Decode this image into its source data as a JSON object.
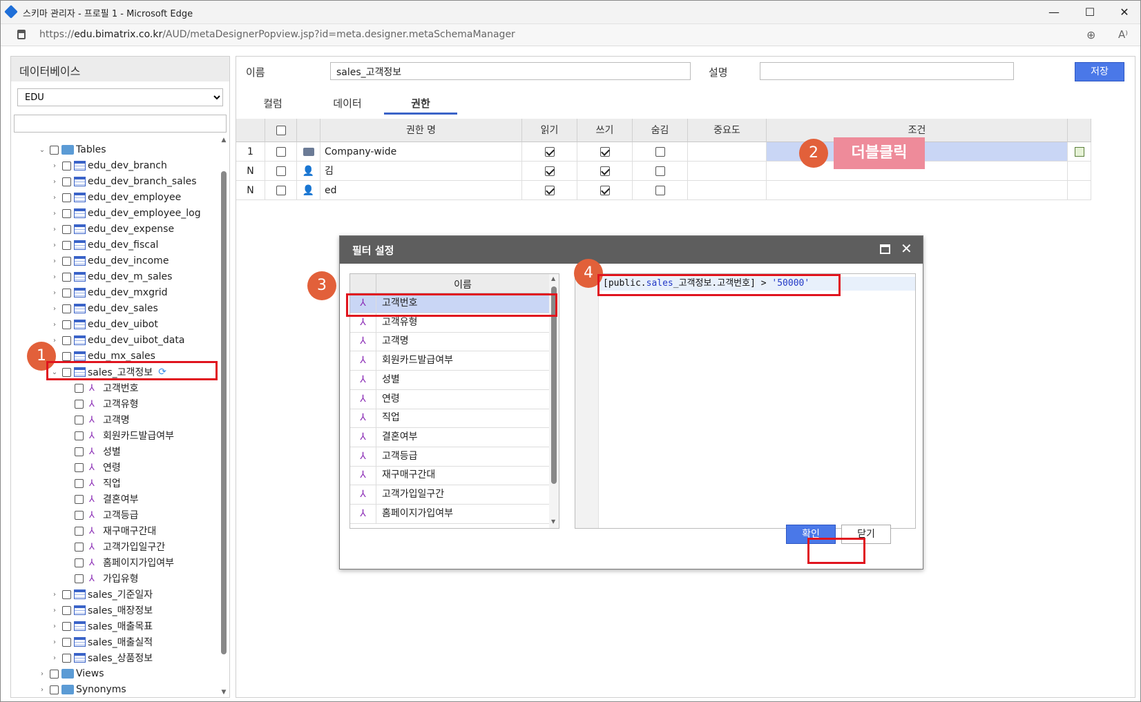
{
  "window": {
    "title": "스키마 관리자 - 프로필 1 - Microsoft Edge",
    "url_prefix": "https://",
    "url_host": "edu.bimatrix.co.kr",
    "url_path": "/AUD/metaDesignerPopview.jsp?id=meta.designer.metaSchemaManager"
  },
  "left": {
    "header": "데이터베이스",
    "db_selected": "EDU",
    "tables_label": "Tables",
    "tables": [
      "edu_dev_branch",
      "edu_dev_branch_sales",
      "edu_dev_employee",
      "edu_dev_employee_log",
      "edu_dev_expense",
      "edu_dev_fiscal",
      "edu_dev_income",
      "edu_dev_m_sales",
      "edu_dev_mxgrid",
      "edu_dev_sales",
      "edu_dev_uibot",
      "edu_dev_uibot_data",
      "edu_mx_sales"
    ],
    "selected_table": "sales_고객정보",
    "columns": [
      "고객번호",
      "고객유형",
      "고객명",
      "회원카드발급여부",
      "성별",
      "연령",
      "직업",
      "결혼여부",
      "고객등급",
      "재구매구간대",
      "고객가입일구간",
      "홈페이지가입여부",
      "가입유형"
    ],
    "tables_after": [
      "sales_기준일자",
      "sales_매장정보",
      "sales_매출목표",
      "sales_매출실적",
      "sales_상품정보"
    ],
    "views_label": "Views",
    "synonyms_label": "Synonyms"
  },
  "form": {
    "name_label": "이름",
    "name_value": "sales_고객정보",
    "desc_label": "설명",
    "desc_value": "",
    "save_label": "저장"
  },
  "tabs": [
    "컬럼",
    "데이터",
    "권한"
  ],
  "active_tab": "권한",
  "grid": {
    "headers": [
      "권한 명",
      "읽기",
      "쓰기",
      "숨김",
      "중요도",
      "조건"
    ],
    "rows": [
      {
        "no": "1",
        "name": "Company-wide",
        "read": true,
        "write": true,
        "hide": false,
        "icon": "chat-icon"
      },
      {
        "no": "N",
        "name": "김",
        "read": true,
        "write": true,
        "hide": false,
        "icon": "user-icon"
      },
      {
        "no": "N",
        "name": "ed",
        "read": true,
        "write": true,
        "hide": false,
        "icon": "user-icon"
      }
    ]
  },
  "annotations": {
    "b1": "1",
    "b2": "2",
    "b3": "3",
    "b4": "4",
    "dblclick": "더블클릭"
  },
  "dialog": {
    "title": "필터 설정",
    "list_header": "이름",
    "items": [
      "고객번호",
      "고객유형",
      "고객명",
      "회원카드발급여부",
      "성별",
      "연령",
      "직업",
      "결혼여부",
      "고객등급",
      "재구매구간대",
      "고객가입일구간",
      "홈페이지가입여부"
    ],
    "code_prefix": "[public.",
    "code_schema": "sales",
    "code_mid": "_고객정보.고객번호] > ",
    "code_value": "'50000'",
    "ok_label": "확인",
    "close_label": "닫기"
  }
}
